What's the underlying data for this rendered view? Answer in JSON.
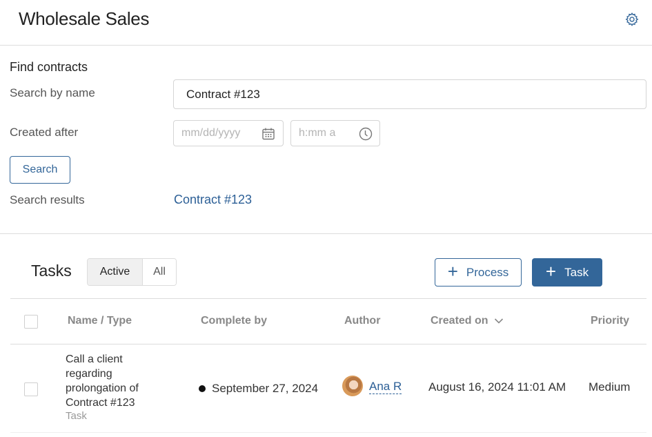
{
  "header": {
    "title": "Wholesale Sales",
    "settings_icon": "gear-icon"
  },
  "find": {
    "title": "Find contracts",
    "name_label": "Search by name",
    "name_value": "Contract #123",
    "created_label": "Created after",
    "date_placeholder": "mm/dd/yyyy",
    "time_placeholder": "h:mm a",
    "search_button": "Search",
    "results_label": "Search results",
    "results": [
      "Contract #123"
    ]
  },
  "tasks": {
    "title": "Tasks",
    "filters": [
      {
        "label": "Active",
        "selected": true
      },
      {
        "label": "All",
        "selected": false
      }
    ],
    "process_button": "Process",
    "task_button": "Task",
    "columns": [
      "Name / Type",
      "Complete by",
      "Author",
      "Created on",
      "Priority"
    ],
    "sort_column": "Created on",
    "rows": [
      {
        "name": "Call a client regarding prolongation of Contract #123",
        "type": "Task",
        "complete_by": "September 27, 2024",
        "author": "Ana R",
        "created_on": "August 16, 2024 11:01 AM",
        "priority": "Medium"
      }
    ]
  },
  "colors": {
    "accent": "#336699",
    "link": "#2c5f96",
    "border": "#dcdcdc"
  }
}
